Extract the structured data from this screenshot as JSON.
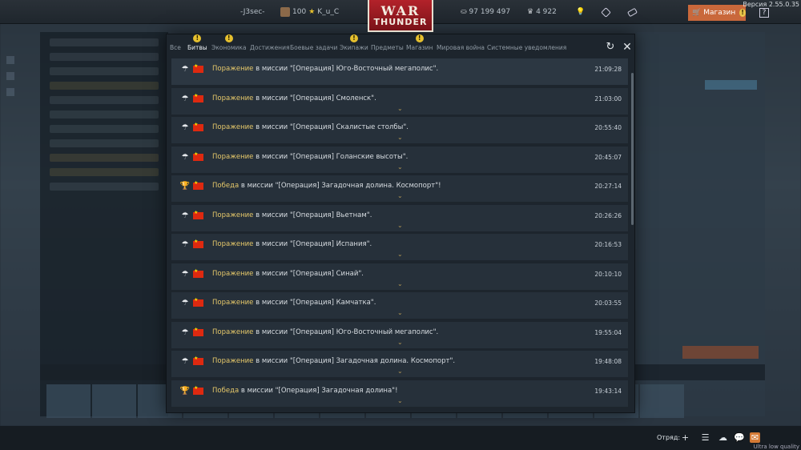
{
  "topbar": {
    "squad_tag": "-J3sec-",
    "level": "100",
    "nickname": "K_u_C",
    "silver_lions": "97 199 497",
    "research_points": "4 922",
    "logo_line1": "WAR",
    "logo_line2": "THUNDER",
    "shop_label": "Магазин",
    "shop_badge": "!",
    "help_label": "?",
    "version": "Версия 2.55.0.35"
  },
  "dialog": {
    "tabs": [
      {
        "label": "Все",
        "warn": false,
        "active": false
      },
      {
        "label": "Битвы",
        "warn": true,
        "active": true
      },
      {
        "label": "Экономика",
        "warn": true,
        "active": false
      },
      {
        "label": "Достижения",
        "warn": false,
        "active": false
      },
      {
        "label": "Боевые задачи",
        "warn": false,
        "active": false
      },
      {
        "label": "Экипажи",
        "warn": true,
        "active": false
      },
      {
        "label": "Предметы",
        "warn": false,
        "active": false
      },
      {
        "label": "Магазин",
        "warn": true,
        "active": false
      },
      {
        "label": "Мировая война",
        "warn": false,
        "active": false
      },
      {
        "label": "Системные уведомления",
        "warn": false,
        "active": false
      }
    ],
    "warn_glyph": "!",
    "refresh_glyph": "↻",
    "close_glyph": "✕",
    "middle_text": "в миссии",
    "chevron": "⌄",
    "items": [
      {
        "result": "Поражение",
        "icon": "parachute-icon",
        "mission": "\"[Операция] Юго-Восточный мегаполис\".",
        "time": "21:09:28"
      },
      {
        "result": "Поражение",
        "icon": "parachute-icon",
        "mission": "\"[Операция] Смоленск\".",
        "time": "21:03:00"
      },
      {
        "result": "Поражение",
        "icon": "parachute-icon",
        "mission": "\"[Операция] Скалистые столбы\".",
        "time": "20:55:40"
      },
      {
        "result": "Поражение",
        "icon": "parachute-icon",
        "mission": "\"[Операция] Голанские высоты\".",
        "time": "20:45:07"
      },
      {
        "result": "Победа",
        "icon": "trophy-icon",
        "mission": "\"[Операция] Загадочная долина. Космопорт\"!",
        "time": "20:27:14"
      },
      {
        "result": "Поражение",
        "icon": "parachute-icon",
        "mission": "\"[Операция] Вьетнам\".",
        "time": "20:26:26"
      },
      {
        "result": "Поражение",
        "icon": "parachute-icon",
        "mission": "\"[Операция] Испания\".",
        "time": "20:16:53"
      },
      {
        "result": "Поражение",
        "icon": "parachute-icon",
        "mission": "\"[Операция] Синай\".",
        "time": "20:10:10"
      },
      {
        "result": "Поражение",
        "icon": "parachute-icon",
        "mission": "\"[Операция] Камчатка\".",
        "time": "20:03:55"
      },
      {
        "result": "Поражение",
        "icon": "parachute-icon",
        "mission": "\"[Операция] Юго-Восточный мегаполис\".",
        "time": "19:55:04"
      },
      {
        "result": "Поражение",
        "icon": "parachute-icon",
        "mission": "\"[Операция] Загадочная долина. Космопорт\".",
        "time": "19:48:08"
      },
      {
        "result": "Победа",
        "icon": "trophy-icon",
        "mission": "\"[Операция] Загадочная долина\"!",
        "time": "19:43:14"
      }
    ]
  },
  "bottombar": {
    "squad_label": "Отряд:",
    "quality": "Ultra low quality"
  },
  "colors": {
    "result_highlight": "#e6c86a",
    "warn": "#e6c02e",
    "shop": "#c9683b",
    "logo": "#b3222a"
  }
}
